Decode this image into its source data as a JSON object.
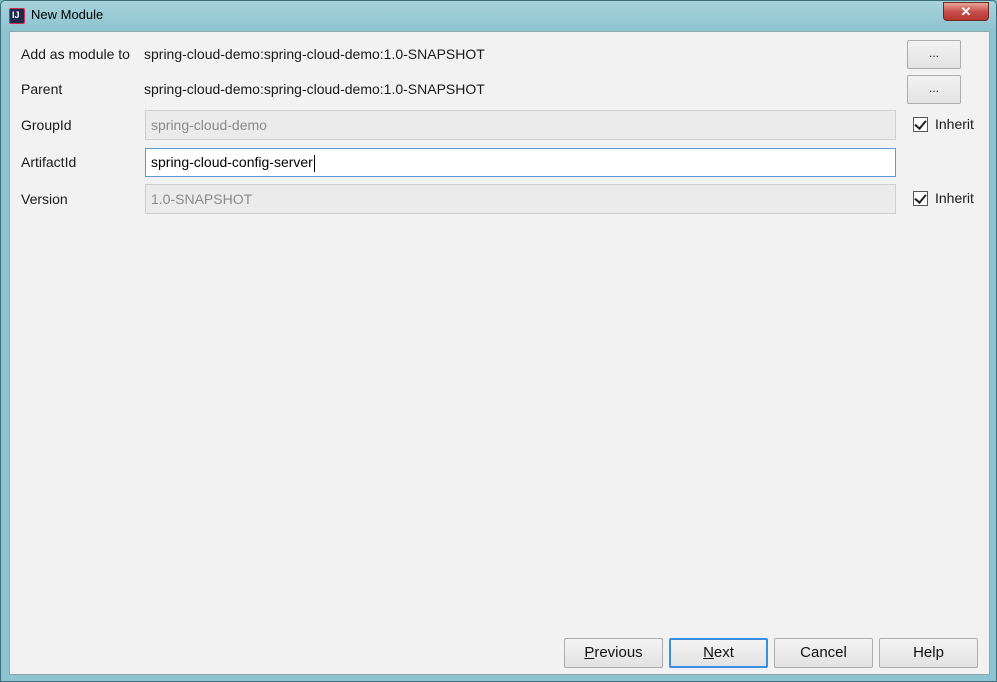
{
  "window": {
    "title": "New Module",
    "close_symbol": "✕"
  },
  "form": {
    "add_as_module_to": {
      "label": "Add as module to",
      "value": "spring-cloud-demo:spring-cloud-demo:1.0-SNAPSHOT",
      "browse_label": "..."
    },
    "parent": {
      "label": "Parent",
      "value": "spring-cloud-demo:spring-cloud-demo:1.0-SNAPSHOT",
      "browse_label": "..."
    },
    "group_id": {
      "label": "GroupId",
      "value": "spring-cloud-demo",
      "inherit_label": "Inherit",
      "inherit_checked": true
    },
    "artifact_id": {
      "label": "ArtifactId",
      "value": "spring-cloud-config-server"
    },
    "version": {
      "label": "Version",
      "value": "1.0-SNAPSHOT",
      "inherit_label": "Inherit",
      "inherit_checked": true
    }
  },
  "footer": {
    "previous_first": "P",
    "previous_rest": "revious",
    "next_first": "N",
    "next_rest": "ext",
    "cancel": "Cancel",
    "help": "Help"
  }
}
